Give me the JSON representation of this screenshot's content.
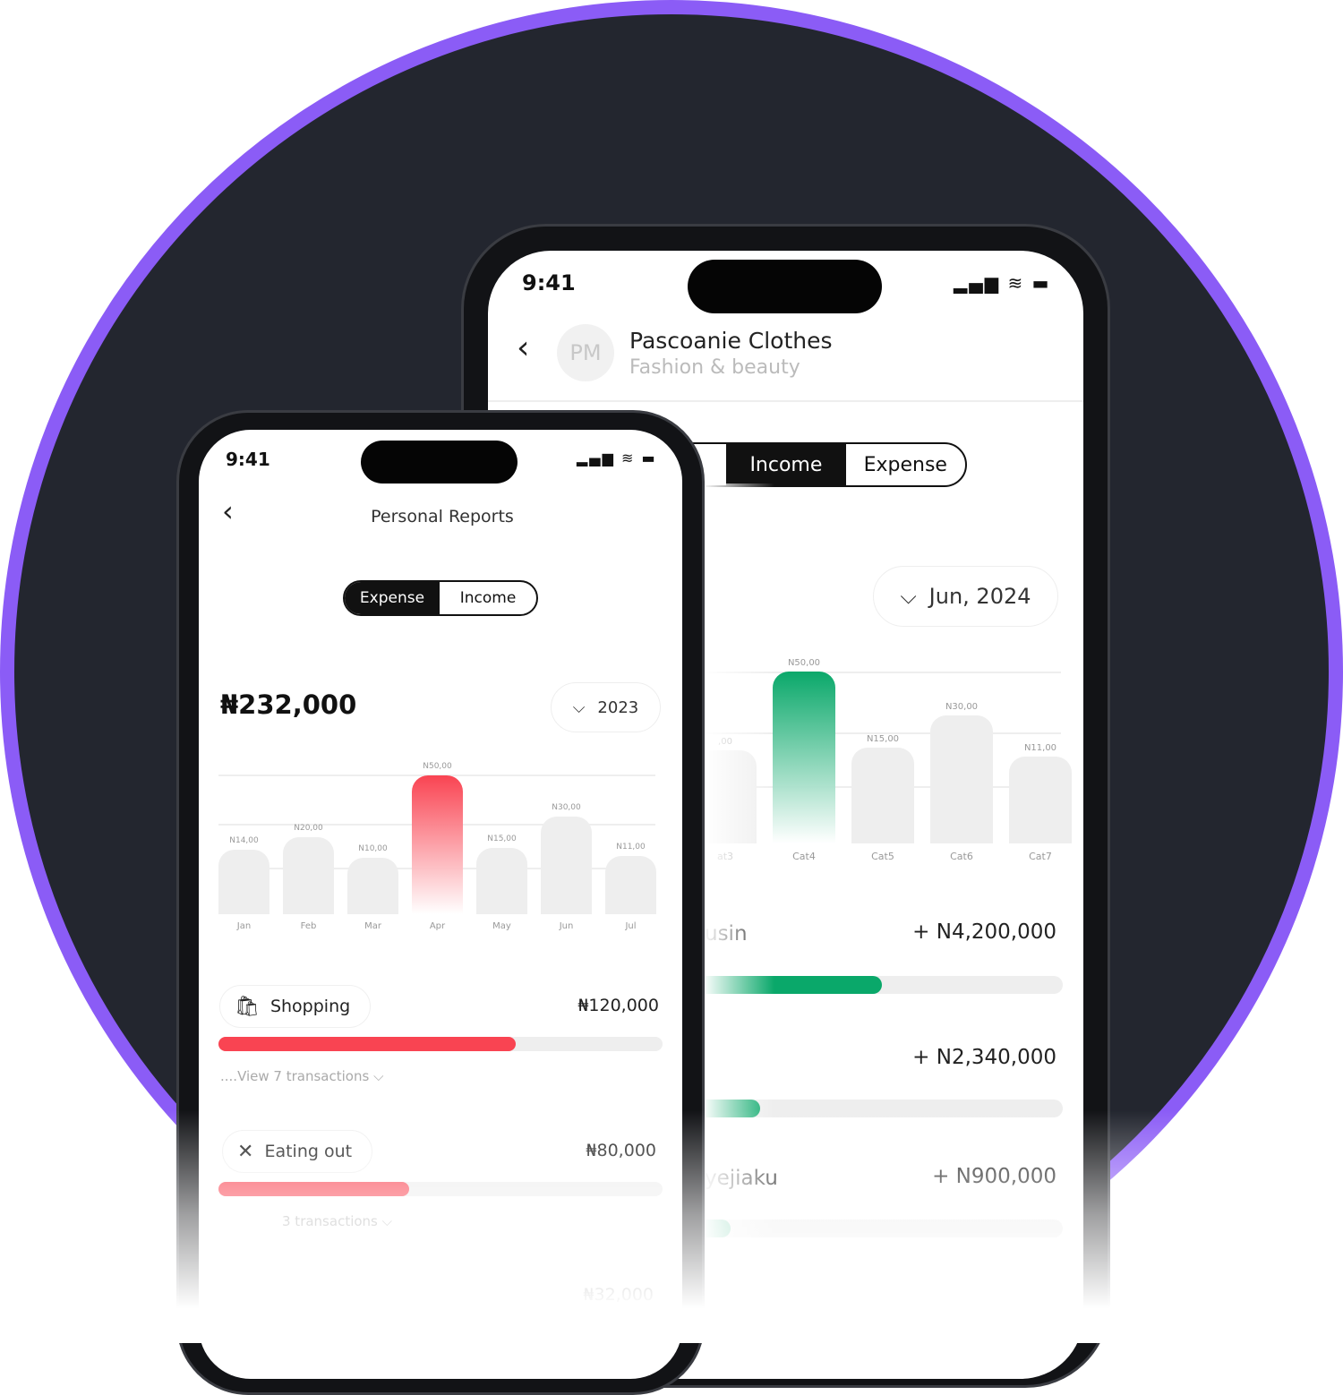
{
  "colors": {
    "accent_ring": "#8b5cf6",
    "background": "#23262f",
    "expense": "#f94452",
    "income": "#0aa86a"
  },
  "business_phone": {
    "status_time": "9:41",
    "back_icon": "chevron-left-icon",
    "avatar_initials": "PM",
    "title": "Pascoanie Clothes",
    "subtitle": "Fashion & beauty",
    "toggle": {
      "income": "Income",
      "expense": "Expense",
      "selected": "Income"
    },
    "period": "Jun, 2024",
    "rows": [
      {
        "label": "usin",
        "amount": "+ N4,200,000",
        "progress": 0.51
      },
      {
        "label": "",
        "amount": "+ N2,340,000",
        "progress": 0.18
      },
      {
        "label": "yejiaku",
        "amount": "+ N900,000",
        "progress": 0.1
      }
    ]
  },
  "personal_phone": {
    "status_time": "9:41",
    "back_icon": "chevron-left-icon",
    "title": "Personal Reports",
    "toggle": {
      "expense": "Expense",
      "income": "Income",
      "selected": "Expense"
    },
    "total": "₦232,000",
    "period": "2023",
    "categories": [
      {
        "icon": "shopping-bag-icon",
        "label": "Shopping",
        "amount": "₦120,000",
        "progress": 0.67,
        "link": "....View 7 transactions"
      },
      {
        "icon": "fork-knife-icon",
        "label": "Eating out",
        "amount": "₦80,000",
        "progress": 0.43,
        "link": "3 transactions"
      },
      {
        "amount": "₦32,000"
      }
    ]
  },
  "chart_data": [
    {
      "type": "bar",
      "highlight": "Apr",
      "highlight_color": "#f94452",
      "categories": [
        "Jan",
        "Feb",
        "Mar",
        "Apr",
        "May",
        "Jun",
        "Jul"
      ],
      "values": [
        14,
        20,
        10,
        50,
        15,
        30,
        11
      ],
      "labels": [
        "N14,00",
        "N20,00",
        "N10,00",
        "N50,00",
        "N15,00",
        "N30,00",
        "N11,00"
      ]
    },
    {
      "type": "bar",
      "highlight": "Cat4",
      "highlight_color": "#0aa86a",
      "categories": [
        "at3",
        "Cat4",
        "Cat5",
        "Cat6",
        "Cat7"
      ],
      "values": [
        14,
        50,
        15,
        30,
        11
      ],
      "labels": [
        ",00",
        "N50,00",
        "N15,00",
        "N30,00",
        "N11,00"
      ]
    }
  ]
}
